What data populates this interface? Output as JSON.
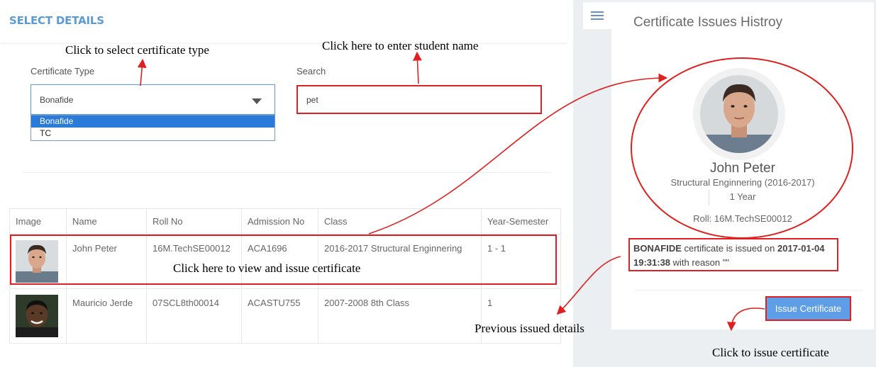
{
  "header": {
    "title": "SELECT DETAILS"
  },
  "annotations": {
    "select_type": "Click to select certificate type",
    "enter_name": "Click here to enter student name",
    "view_issue": "Click here to view and issue certificate",
    "prev_details": "Previous issued details",
    "issue_cert": "Click to issue certificate"
  },
  "form": {
    "cert_type_label": "Certificate Type",
    "cert_type_value": "Bonafide",
    "cert_type_options": [
      "Bonafide",
      "TC"
    ],
    "search_label": "Search",
    "search_value": "pet"
  },
  "table": {
    "headers": [
      "Image",
      "Name",
      "Roll No",
      "Admission No",
      "Class",
      "Year-Semester"
    ],
    "rows": [
      {
        "name": "John Peter",
        "roll": "16M.TechSE00012",
        "admission": "ACA1696",
        "class": "2016-2017 Structural Enginnering",
        "year_sem": "1 - 1"
      },
      {
        "name": "Mauricio Jerde",
        "roll": "07SCL8th00014",
        "admission": "ACASTU755",
        "class": "2007-2008 8th Class",
        "year_sem": "1"
      }
    ]
  },
  "history": {
    "title": "Certificate Issues Histroy",
    "name": "John Peter",
    "course": "Structural Enginnering (2016-2017)",
    "year": "1 Year",
    "roll": "Roll: 16M.TechSE00012",
    "issue_type": "BONAFIDE",
    "issue_mid": " certificate is issued on ",
    "issue_date": "2017-01-04",
    "issue_time": "19:31:38",
    "issue_end": " with reason  \"\"",
    "button": "Issue Certificate"
  },
  "colors": {
    "accent": "#5b9bd5",
    "highlight": "#e02020",
    "button": "#5d9ee6"
  },
  "icons": {
    "menu": "hamburger-menu-icon",
    "dropdown": "caret-down-icon"
  }
}
